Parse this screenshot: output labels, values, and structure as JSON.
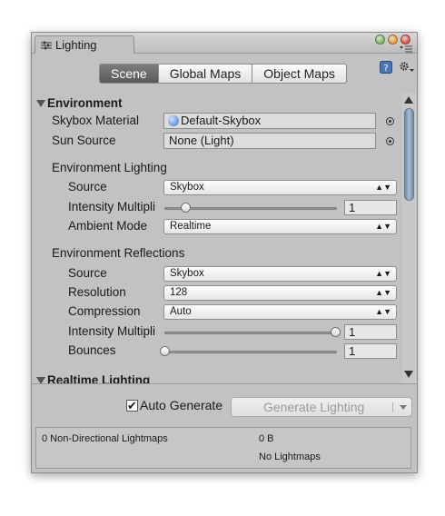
{
  "window": {
    "tab_title": "Lighting",
    "tab_icon": "lighting-icon",
    "traffic_colors": [
      "#7cc15f",
      "#e8a23b",
      "#e25a4a"
    ]
  },
  "tabs": [
    {
      "label": "Scene",
      "active": true
    },
    {
      "label": "Global Maps",
      "active": false
    },
    {
      "label": "Object Maps",
      "active": false
    }
  ],
  "header_icons": [
    "help-book-icon",
    "settings-gear-icon"
  ],
  "environment": {
    "title": "Environment",
    "skybox_label": "Skybox Material",
    "skybox_value": "Default-Skybox",
    "sun_label": "Sun Source",
    "sun_value": "None (Light)",
    "lighting_header": "Environment Lighting",
    "lighting": {
      "source_label": "Source",
      "source_value": "Skybox",
      "intensity_label": "Intensity Multipli",
      "intensity_value": "1",
      "intensity_fraction": 0.125,
      "ambient_label": "Ambient Mode",
      "ambient_value": "Realtime"
    },
    "reflections_header": "Environment Reflections",
    "reflections": {
      "source_label": "Source",
      "source_value": "Skybox",
      "resolution_label": "Resolution",
      "resolution_value": "128",
      "compression_label": "Compression",
      "compression_value": "Auto",
      "intensity_label": "Intensity Multipli",
      "intensity_value": "1",
      "intensity_fraction": 1.0,
      "bounces_label": "Bounces",
      "bounces_value": "1",
      "bounces_fraction": 0.0
    }
  },
  "next_section": "Realtime Lighting",
  "bottom": {
    "auto_generate_label": "Auto Generate",
    "auto_generate_checked": true,
    "generate_button": "Generate Lighting",
    "lightmaps_label": "0 Non-Directional Lightmaps",
    "size_value": "0 B",
    "status": "No Lightmaps"
  }
}
